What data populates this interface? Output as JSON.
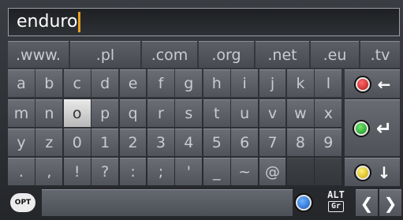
{
  "input": {
    "value": "enduro"
  },
  "domain_row": [
    ".www.",
    ".pl",
    ".com",
    ".org",
    ".net",
    ".eu",
    ".tv"
  ],
  "rows": [
    [
      "a",
      "b",
      "c",
      "d",
      "e",
      "f",
      "g",
      "h",
      "i",
      "j",
      "k",
      "l"
    ],
    [
      "m",
      "n",
      "o",
      "p",
      "q",
      "r",
      "s",
      "t",
      "u",
      "v",
      "w",
      "x"
    ],
    [
      "y",
      "z",
      "0",
      "1",
      "2",
      "3",
      "4",
      "5",
      "6",
      "7",
      "8",
      "9"
    ],
    [
      ".",
      ",",
      "!",
      "?",
      ":",
      ";",
      "'",
      "_",
      "~",
      "@",
      "",
      ""
    ]
  ],
  "selected_key": "o",
  "function_keys": {
    "backspace": {
      "color": "red",
      "icon": "backspace-arrow-icon",
      "glyph": "🡐"
    },
    "enter": {
      "color": "green",
      "icon": "enter-icon",
      "glyph": "↵"
    },
    "shift": {
      "color": "yellow",
      "icon": "down-arrow-icon",
      "glyph": "↓"
    }
  },
  "bottom": {
    "opt_label": "OPT",
    "alt_label": "ALT",
    "alt_sub": "Gr",
    "left_arrow": "〈",
    "right_arrow": "〉"
  },
  "colors": {
    "red": "#d42a2a",
    "green": "#2bb830",
    "yellow": "#f0d020",
    "blue": "#2a6ed8",
    "cursor": "#e8a024"
  }
}
